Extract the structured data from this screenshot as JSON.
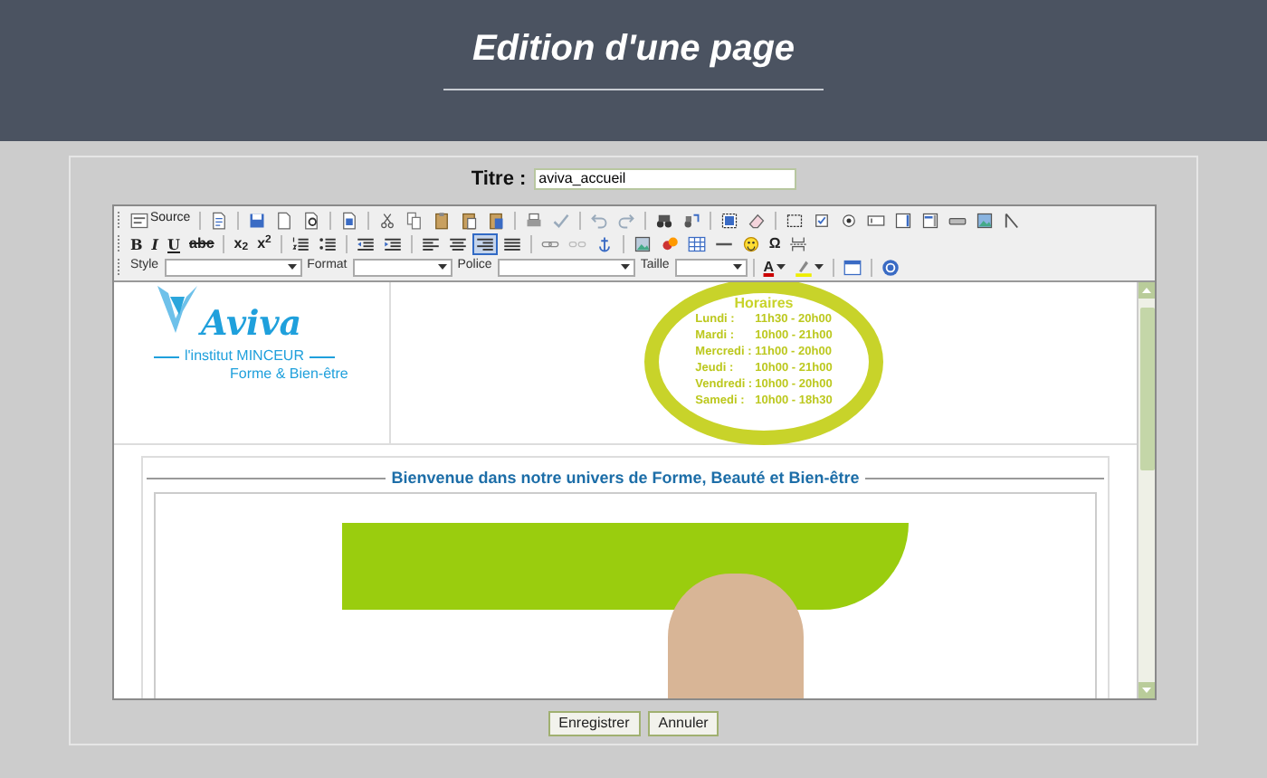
{
  "header": {
    "title": "Edition d'une page"
  },
  "form": {
    "title_label": "Titre :",
    "title_value": "aviva_accueil"
  },
  "toolbar": {
    "lines": [
      {
        "items": [
          {
            "kind": "source",
            "label": "Source",
            "on": false
          },
          {
            "kind": "sep"
          },
          {
            "kind": "templates",
            "on": false
          },
          {
            "kind": "sep"
          },
          {
            "kind": "save",
            "on": false
          },
          {
            "kind": "newpage",
            "on": false
          },
          {
            "kind": "preview",
            "on": false
          },
          {
            "kind": "sep"
          },
          {
            "kind": "doc",
            "on": false
          },
          {
            "kind": "sep"
          },
          {
            "kind": "cut",
            "on": false
          },
          {
            "kind": "copy",
            "on": false
          },
          {
            "kind": "paste",
            "on": false
          },
          {
            "kind": "pastetext",
            "on": false
          },
          {
            "kind": "pasteword",
            "on": false
          },
          {
            "kind": "sep"
          },
          {
            "kind": "print",
            "on": false
          },
          {
            "kind": "spell",
            "on": false
          },
          {
            "kind": "sep"
          },
          {
            "kind": "undo",
            "on": false
          },
          {
            "kind": "redo",
            "on": false
          },
          {
            "kind": "sep"
          },
          {
            "kind": "find",
            "on": false
          },
          {
            "kind": "replace",
            "on": false
          },
          {
            "kind": "sep"
          },
          {
            "kind": "selectall",
            "on": false
          },
          {
            "kind": "eraser",
            "on": false
          },
          {
            "kind": "sep"
          },
          {
            "kind": "form",
            "on": false
          },
          {
            "kind": "checkbox",
            "on": false
          },
          {
            "kind": "radio",
            "on": false
          },
          {
            "kind": "textfield",
            "on": false
          },
          {
            "kind": "textarea",
            "on": false
          },
          {
            "kind": "select",
            "on": false
          },
          {
            "kind": "button",
            "on": false
          },
          {
            "kind": "imagebutton",
            "on": false
          },
          {
            "kind": "hidden",
            "on": false
          }
        ]
      },
      {
        "items": [
          {
            "kind": "bold",
            "label": "B",
            "on": false
          },
          {
            "kind": "italic",
            "label": "I",
            "on": false
          },
          {
            "kind": "underline",
            "label": "U",
            "on": false
          },
          {
            "kind": "strike",
            "label": "abc",
            "on": false
          },
          {
            "kind": "sep"
          },
          {
            "kind": "sub",
            "label": "x$_{2}$",
            "on": false
          },
          {
            "kind": "sup",
            "label": "x$^{2}$",
            "on": false
          },
          {
            "kind": "sep"
          },
          {
            "kind": "ol",
            "on": false
          },
          {
            "kind": "ul",
            "on": false
          },
          {
            "kind": "sep"
          },
          {
            "kind": "outdent",
            "on": false
          },
          {
            "kind": "indent",
            "on": false
          },
          {
            "kind": "sep"
          },
          {
            "kind": "alignleft",
            "on": false
          },
          {
            "kind": "aligncenter",
            "on": false
          },
          {
            "kind": "alignright",
            "on": true
          },
          {
            "kind": "justify",
            "on": false
          },
          {
            "kind": "sep"
          },
          {
            "kind": "link",
            "on": false
          },
          {
            "kind": "unlink",
            "on": false
          },
          {
            "kind": "anchor",
            "on": false
          },
          {
            "kind": "sep"
          },
          {
            "kind": "image",
            "on": false
          },
          {
            "kind": "flash",
            "on": false
          },
          {
            "kind": "table",
            "on": false
          },
          {
            "kind": "hr",
            "on": false
          },
          {
            "kind": "smiley",
            "on": false
          },
          {
            "kind": "char",
            "label": "Ω",
            "on": false
          },
          {
            "kind": "pagebreak",
            "on": false
          }
        ]
      },
      {
        "items": [
          {
            "kind": "combo",
            "label": "Style"
          },
          {
            "kind": "combo",
            "label": "Format"
          },
          {
            "kind": "combo",
            "label": "Police"
          },
          {
            "kind": "combo",
            "label": "Taille"
          },
          {
            "kind": "sep"
          },
          {
            "kind": "textcolor",
            "label": "A",
            "on": false
          },
          {
            "kind": "bgcolor",
            "on": false
          },
          {
            "kind": "sep"
          },
          {
            "kind": "maximize",
            "on": false
          },
          {
            "kind": "sep"
          },
          {
            "kind": "about",
            "on": false
          }
        ]
      }
    ]
  },
  "content": {
    "logo": {
      "name": "Aviva",
      "line1": "l'institut MINCEUR",
      "line2": "Forme & Bien-être"
    },
    "hours": {
      "title": "Horaires",
      "rows": [
        {
          "day": "Lundi :",
          "time": "11h30 - 20h00"
        },
        {
          "day": "Mardi :",
          "time": "10h00 - 21h00"
        },
        {
          "day": "Mercredi :",
          "time": "11h00 - 20h00"
        },
        {
          "day": "Jeudi :",
          "time": "10h00 - 21h00"
        },
        {
          "day": "Vendredi :",
          "time": "10h00 - 20h00"
        },
        {
          "day": "Samedi :",
          "time": "10h00 - 18h30"
        }
      ]
    },
    "welcome": "Bienvenue dans notre univers de Forme, Beauté et Bien-être"
  },
  "buttons": [
    "Enregistrer",
    "Annuler"
  ]
}
